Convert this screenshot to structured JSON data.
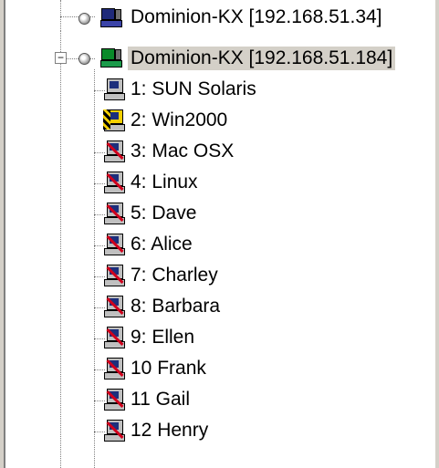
{
  "tree": {
    "devices": [
      {
        "label": "Dominion-KX [192.168.51.34]",
        "icon": "dominion-device-icon",
        "selected": false,
        "expanded": false
      },
      {
        "label": "Dominion-KX [192.168.51.184]",
        "icon": "dominion-device-icon-active",
        "selected": true,
        "expanded": true,
        "expander": "−"
      }
    ],
    "ports": [
      {
        "label": "1: SUN Solaris",
        "icon": "computer-icon",
        "status": "available"
      },
      {
        "label": "2: Win2000",
        "icon": "computer-busy-icon",
        "status": "busy"
      },
      {
        "label": "3: Mac OSX",
        "icon": "computer-disconnected-icon",
        "status": "disconnected"
      },
      {
        "label": "4: Linux",
        "icon": "computer-disconnected-icon",
        "status": "disconnected"
      },
      {
        "label": "5: Dave",
        "icon": "computer-disconnected-icon",
        "status": "disconnected"
      },
      {
        "label": "6: Alice",
        "icon": "computer-disconnected-icon",
        "status": "disconnected"
      },
      {
        "label": "7: Charley",
        "icon": "computer-disconnected-icon",
        "status": "disconnected"
      },
      {
        "label": "8: Barbara",
        "icon": "computer-disconnected-icon",
        "status": "disconnected"
      },
      {
        "label": "9: Ellen",
        "icon": "computer-disconnected-icon",
        "status": "disconnected"
      },
      {
        "label": "10 Frank",
        "icon": "computer-disconnected-icon",
        "status": "disconnected"
      },
      {
        "label": "11 Gail",
        "icon": "computer-disconnected-icon",
        "status": "disconnected"
      },
      {
        "label": "12 Henry",
        "icon": "computer-disconnected-icon",
        "status": "disconnected"
      }
    ]
  },
  "colors": {
    "selection": "#d4d0c8",
    "guide_line": "#808080",
    "disconnected_slash": "#d0001c"
  }
}
